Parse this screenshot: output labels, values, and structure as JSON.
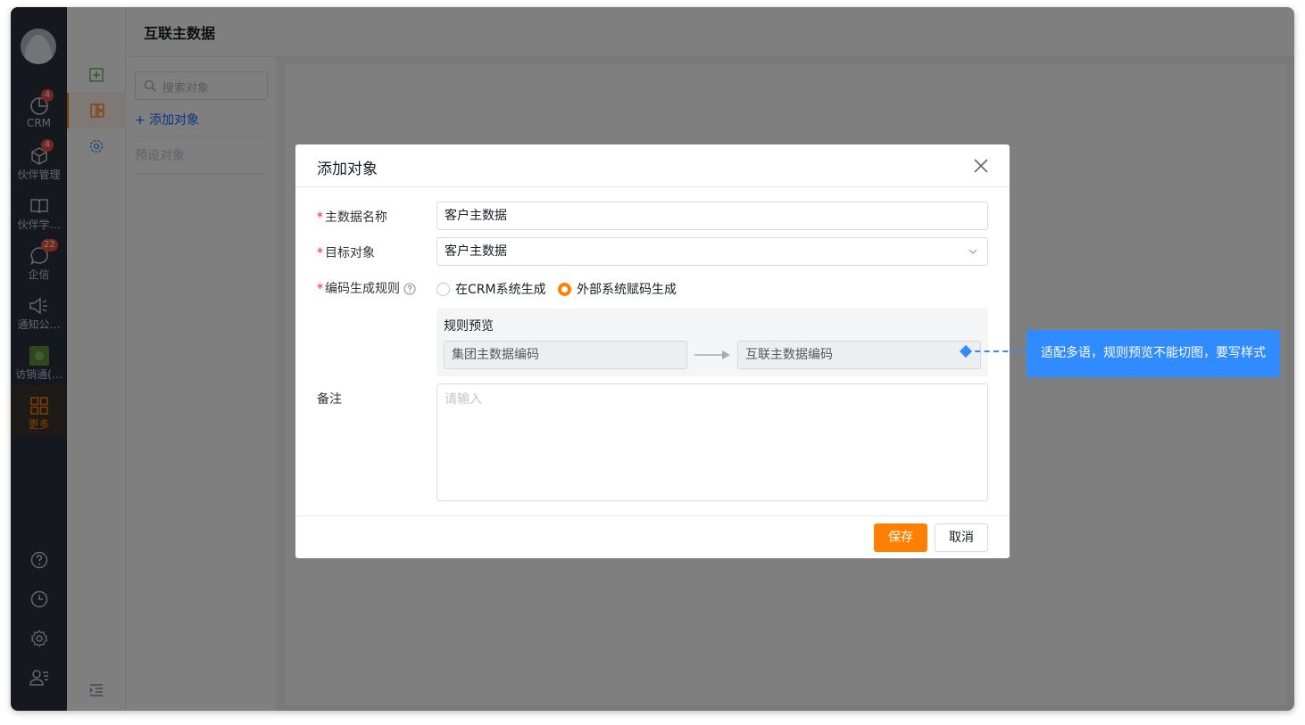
{
  "rail": {
    "items": [
      {
        "label": "CRM",
        "icon": "pie-chart-icon",
        "badge": "4"
      },
      {
        "label": "伙伴管理",
        "icon": "cube-icon",
        "badge": "4"
      },
      {
        "label": "伙伴学…",
        "icon": "book-icon",
        "badge": ""
      },
      {
        "label": "企信",
        "icon": "chat-bubble-icon",
        "badge": "22"
      },
      {
        "label": "通知公…",
        "icon": "megaphone-icon",
        "badge": ""
      },
      {
        "label": "访销通(…",
        "icon": "app-logo-icon",
        "badge": ""
      },
      {
        "label": "更多",
        "icon": "grid-icon",
        "badge": ""
      }
    ],
    "bottom_icons": [
      "help-icon",
      "history-clock-icon",
      "settings-gear-icon",
      "user-list-icon"
    ]
  },
  "header": {
    "title": "互联主数据"
  },
  "list": {
    "search_placeholder": "搜索对象",
    "add_label": "+ 添加对象",
    "preset_label": "预设对象"
  },
  "dialog": {
    "title": "添加对象",
    "fields": {
      "name_label": "主数据名称",
      "name_value": "客户主数据",
      "target_label": "目标对象",
      "target_value": "客户主数据",
      "rule_label": "编码生成规则",
      "rule_options": [
        "在CRM系统生成",
        "外部系统赋码生成"
      ],
      "rule_selected": 1,
      "preview_title": "规则预览",
      "preview_source": "集团主数据编码",
      "preview_target": "互联主数据编码",
      "remark_label": "备注",
      "remark_placeholder": "请输入"
    },
    "buttons": {
      "save": "保存",
      "cancel": "取消"
    }
  },
  "annotation": {
    "text": "适配多语，规则预览不能切图，要写样式"
  },
  "colors": {
    "accent": "#ff8000",
    "annotation": "#2f8bff",
    "rail_bg": "#2b313d",
    "required": "#f5222d"
  }
}
